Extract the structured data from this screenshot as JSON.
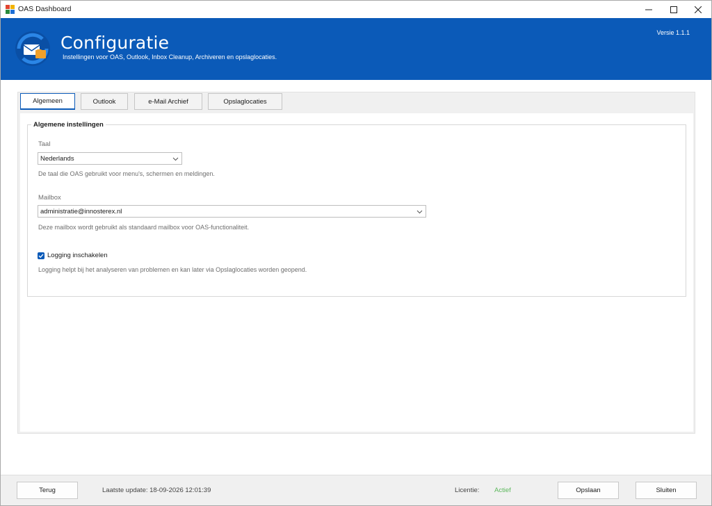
{
  "window": {
    "title": "OAS Dashboard",
    "icons": {
      "app": "app-icon",
      "minimize": "minimize-icon",
      "maximize": "maximize-icon",
      "close": "close-icon"
    }
  },
  "header": {
    "title": "Configuratie",
    "subtitle": "Instellingen voor OAS, Outlook, Inbox Cleanup, Archiveren en opslaglocaties.",
    "version": "Versie 1.1.1",
    "logo_icon": "mail-settings-icon",
    "color": "#0b5ab8"
  },
  "tabs": [
    {
      "label": "Algemeen",
      "active": true
    },
    {
      "label": "Outlook",
      "active": false
    },
    {
      "label": "e-Mail Archief",
      "active": false
    },
    {
      "label": "Opslaglocaties",
      "active": false
    }
  ],
  "general": {
    "group_title": "Algemene instellingen",
    "language": {
      "label": "Taal",
      "value": "Nederlands",
      "hint": "De taal die OAS gebruikt voor menu's, schermen en meldingen."
    },
    "mailbox": {
      "label": "Mailbox",
      "value": "administratie@innosterex.nl",
      "hint": "Deze mailbox wordt gebruikt als standaard mailbox voor OAS-functionaliteit."
    },
    "logging": {
      "label": "Logging inschakelen",
      "checked": true,
      "hint": "Logging helpt bij het analyseren van problemen en kan later via Opslaglocaties worden geopend."
    }
  },
  "footer": {
    "back_label": "Terug",
    "last_update": "Laatste update: 18-09-2026 12:01:39",
    "license_label": "Licentie:",
    "license_status": "Actief",
    "license_color": "#5cb85c",
    "save_label": "Opslaan",
    "close_label": "Sluiten"
  }
}
